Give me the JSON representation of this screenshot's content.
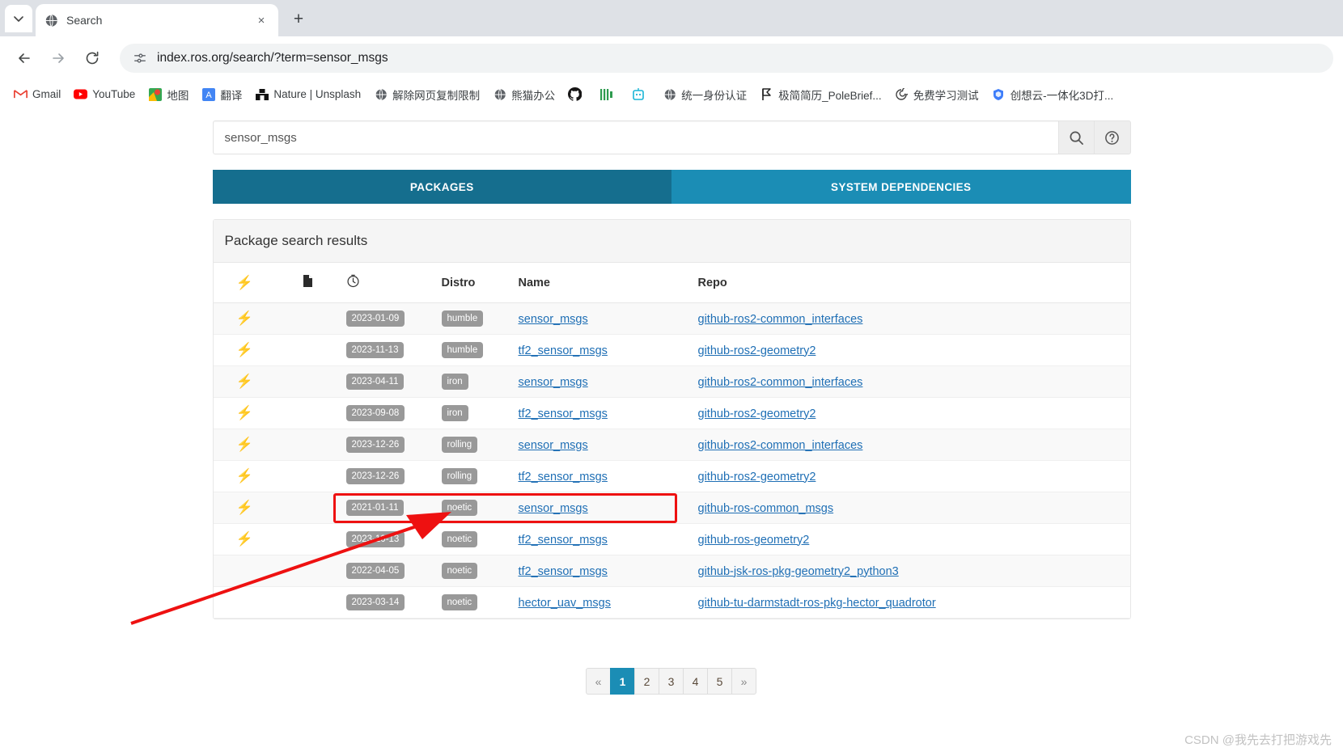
{
  "browser": {
    "tab": {
      "title": "Search",
      "favicon": "globe-icon",
      "close": "×"
    },
    "new_tab": "+",
    "tab_list": "⌄",
    "nav": {
      "back": "←",
      "forward": "→",
      "reload": "↻"
    },
    "omnibox": {
      "url": "index.ros.org/search/?term=sensor_msgs",
      "site_icon": "page-info-icon"
    },
    "bookmarks": [
      {
        "label": "Gmail",
        "icon": "gmail-icon",
        "color": "#ea4335"
      },
      {
        "label": "YouTube",
        "icon": "youtube-icon",
        "color": "#ff0000"
      },
      {
        "label": "地图",
        "icon": "google-maps-icon",
        "color": "#34a853"
      },
      {
        "label": "翻译",
        "icon": "google-translate-icon",
        "color": "#4285f4"
      },
      {
        "label": "Nature | Unsplash",
        "icon": "unsplash-icon",
        "color": "#111111"
      },
      {
        "label": "解除网页复制限制",
        "icon": "globe-icon",
        "color": "#555555"
      },
      {
        "label": "熊猫办公",
        "icon": "globe-icon",
        "color": "#555555"
      },
      {
        "label": "",
        "icon": "github-icon",
        "color": "#181717"
      },
      {
        "label": "",
        "icon": "bars-icon",
        "color": "#2e9b4f"
      },
      {
        "label": "",
        "icon": "robot-icon",
        "color": "#19b5d6"
      },
      {
        "label": "统一身份认证",
        "icon": "globe-icon",
        "color": "#555555"
      },
      {
        "label": "极简简历_PoleBrief...",
        "icon": "flag-icon",
        "color": "#222222"
      },
      {
        "label": "免费学习测试",
        "icon": "spiral-icon",
        "color": "#444444"
      },
      {
        "label": "创想云-一体化3D打...",
        "icon": "shield-icon",
        "color": "#3d7dfa"
      }
    ]
  },
  "search": {
    "value": "sensor_msgs",
    "placeholder": "",
    "search_button_icon": "search-icon",
    "help_button_icon": "question-circle-icon"
  },
  "tabs": [
    {
      "label": "PACKAGES",
      "active": true
    },
    {
      "label": "SYSTEM DEPENDENCIES",
      "active": false
    }
  ],
  "panel": {
    "title": "Package search results",
    "columns": [
      {
        "key": "bolt",
        "label": "",
        "icon": "bolt-icon"
      },
      {
        "key": "doc",
        "label": "",
        "icon": "document-icon"
      },
      {
        "key": "date",
        "label": "",
        "icon": "clock-icon"
      },
      {
        "key": "distro",
        "label": "Distro",
        "icon": ""
      },
      {
        "key": "name",
        "label": "Name",
        "icon": ""
      },
      {
        "key": "repo",
        "label": "Repo",
        "icon": ""
      }
    ],
    "rows": [
      {
        "bolt": true,
        "doc": false,
        "date": "2023-01-09",
        "distro": "humble",
        "name": "sensor_msgs",
        "repo": "github-ros2-common_interfaces"
      },
      {
        "bolt": true,
        "doc": false,
        "date": "2023-11-13",
        "distro": "humble",
        "name": "tf2_sensor_msgs",
        "repo": "github-ros2-geometry2"
      },
      {
        "bolt": true,
        "doc": false,
        "date": "2023-04-11",
        "distro": "iron",
        "name": "sensor_msgs",
        "repo": "github-ros2-common_interfaces"
      },
      {
        "bolt": true,
        "doc": false,
        "date": "2023-09-08",
        "distro": "iron",
        "name": "tf2_sensor_msgs",
        "repo": "github-ros2-geometry2"
      },
      {
        "bolt": true,
        "doc": false,
        "date": "2023-12-26",
        "distro": "rolling",
        "name": "sensor_msgs",
        "repo": "github-ros2-common_interfaces"
      },
      {
        "bolt": true,
        "doc": false,
        "date": "2023-12-26",
        "distro": "rolling",
        "name": "tf2_sensor_msgs",
        "repo": "github-ros2-geometry2"
      },
      {
        "bolt": true,
        "doc": false,
        "date": "2021-01-11",
        "distro": "noetic",
        "name": "sensor_msgs",
        "repo": "github-ros-common_msgs"
      },
      {
        "bolt": true,
        "doc": false,
        "date": "2023-10-13",
        "distro": "noetic",
        "name": "tf2_sensor_msgs",
        "repo": "github-ros-geometry2"
      },
      {
        "bolt": false,
        "doc": false,
        "date": "2022-04-05",
        "distro": "noetic",
        "name": "tf2_sensor_msgs",
        "repo": "github-jsk-ros-pkg-geometry2_python3"
      },
      {
        "bolt": false,
        "doc": false,
        "date": "2023-03-14",
        "distro": "noetic",
        "name": "hector_uav_msgs",
        "repo": "github-tu-darmstadt-ros-pkg-hector_quadrotor"
      }
    ]
  },
  "pagination": {
    "prev": "«",
    "next": "»",
    "pages": [
      "1",
      "2",
      "3",
      "4",
      "5"
    ],
    "active": "1"
  },
  "annotation": {
    "highlight_row_index": 6,
    "highlight_color": "#ee1111",
    "arrow_color": "#ee1111"
  },
  "watermark": "CSDN @我先去打把游戏先"
}
